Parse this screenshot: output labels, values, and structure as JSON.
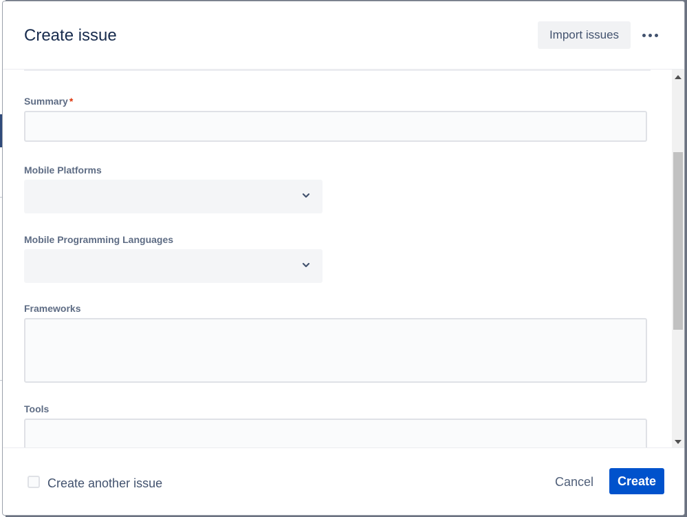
{
  "dialog": {
    "title": "Create issue",
    "import_label": "Import issues",
    "more_icon": "more-horizontal-icon"
  },
  "fields": {
    "summary": {
      "label": "Summary",
      "required_mark": "*",
      "value": ""
    },
    "mobile_platforms": {
      "label": "Mobile Platforms",
      "value": ""
    },
    "mobile_languages": {
      "label": "Mobile Programming Languages",
      "value": ""
    },
    "frameworks": {
      "label": "Frameworks",
      "value": ""
    },
    "tools": {
      "label": "Tools",
      "value": ""
    }
  },
  "footer": {
    "create_another_label": "Create another issue",
    "create_another_checked": false,
    "cancel_label": "Cancel",
    "create_label": "Create"
  },
  "colors": {
    "primary": "#0052cc",
    "required": "#de350b"
  }
}
